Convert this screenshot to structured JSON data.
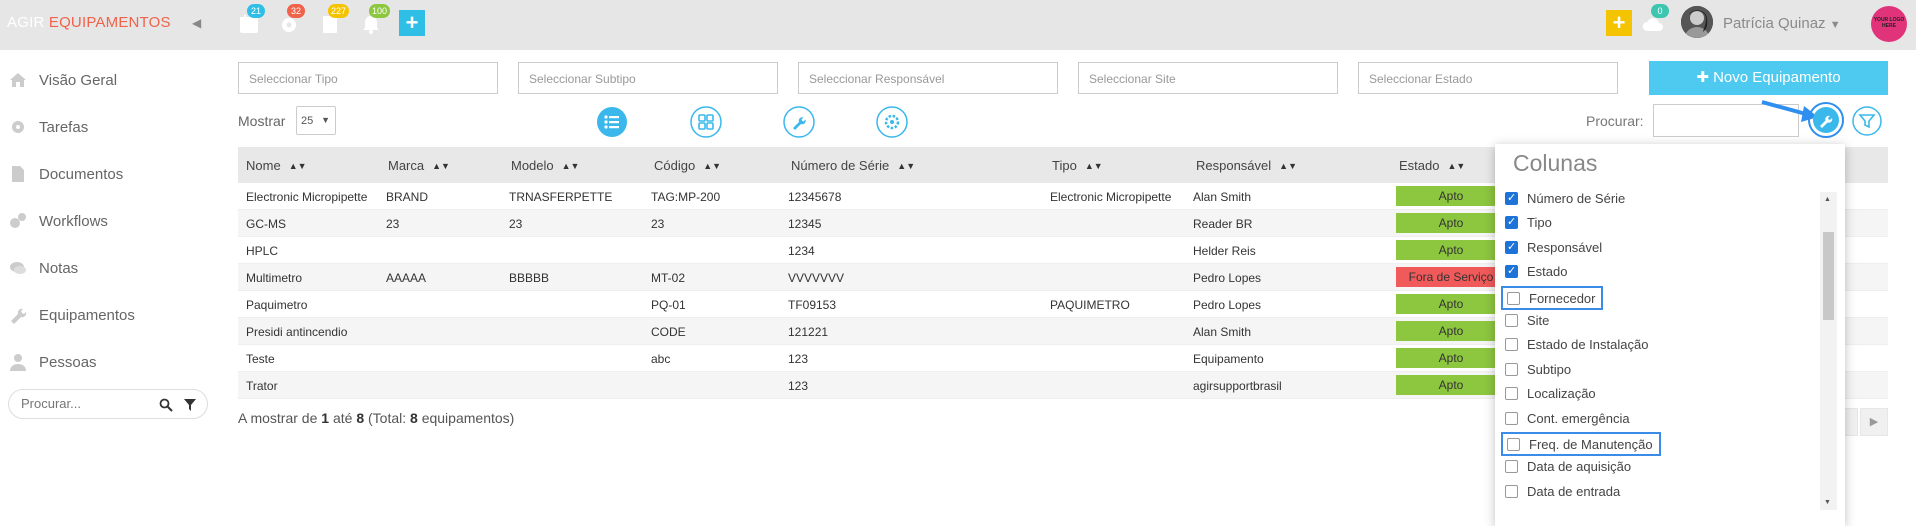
{
  "brand": {
    "part1": "AGIR",
    "part2": "EQUIPAMENTOS"
  },
  "topbar": {
    "badges": [
      {
        "name": "calendar-icon",
        "count": "21",
        "color": "#2fbfe6"
      },
      {
        "name": "gear-icon",
        "count": "32",
        "color": "#f0624a"
      },
      {
        "name": "document-icon",
        "count": "227",
        "color": "#f5c400"
      },
      {
        "name": "bell-icon",
        "count": "100",
        "color": "#8dc63f"
      }
    ],
    "cloud_count": "0",
    "user_name": "Patrícia Quinaz",
    "logo_text": "YOUR LOGO HERE"
  },
  "sidebar": {
    "items": [
      {
        "label": "Visão Geral",
        "icon": "home-icon"
      },
      {
        "label": "Tarefas",
        "icon": "gear-icon"
      },
      {
        "label": "Documentos",
        "icon": "document-icon"
      },
      {
        "label": "Workflows",
        "icon": "gears-icon"
      },
      {
        "label": "Notas",
        "icon": "chat-icon"
      },
      {
        "label": "Equipamentos",
        "icon": "wrench-icon"
      },
      {
        "label": "Pessoas",
        "icon": "person-icon"
      }
    ],
    "search_placeholder": "Procurar..."
  },
  "filters": {
    "tipo": "Seleccionar Tipo",
    "subtipo": "Seleccionar Subtipo",
    "responsavel": "Seleccionar Responsável",
    "site": "Seleccionar Site",
    "estado": "Seleccionar Estado"
  },
  "novo_button": "✚ Novo Equipamento",
  "toolbar": {
    "mostrar_label": "Mostrar",
    "mostrar_value": "25",
    "procurar_label": "Procurar:"
  },
  "table": {
    "headers": [
      "Nome",
      "Marca",
      "Modelo",
      "Código",
      "Número de Série",
      "Tipo",
      "Responsável",
      "Estado"
    ],
    "rows": [
      {
        "nome": "Electronic Micropipette",
        "marca": "BRAND",
        "modelo": "TRNASFERPETTE",
        "codigo": "TAG:MP-200",
        "serie": "12345678",
        "tipo": "Electronic Micropipette",
        "responsavel": "Alan Smith",
        "estado": "Apto"
      },
      {
        "nome": "GC-MS",
        "marca": "23",
        "modelo": "23",
        "codigo": "23",
        "serie": "12345",
        "tipo": "",
        "responsavel": "Reader BR",
        "estado": "Apto"
      },
      {
        "nome": "HPLC",
        "marca": "",
        "modelo": "",
        "codigo": "",
        "serie": "1234",
        "tipo": "",
        "responsavel": "Helder Reis",
        "estado": "Apto"
      },
      {
        "nome": "Multimetro",
        "marca": "AAAAA",
        "modelo": "BBBBB",
        "codigo": "MT-02",
        "serie": "VVVVVVV",
        "tipo": "",
        "responsavel": "Pedro Lopes",
        "estado": "Fora de Serviço"
      },
      {
        "nome": "Paquimetro",
        "marca": "",
        "modelo": "",
        "codigo": "PQ-01",
        "serie": "TF09153",
        "tipo": "PAQUIMETRO",
        "responsavel": "Pedro Lopes",
        "estado": "Apto"
      },
      {
        "nome": "Presidi antincendio",
        "marca": "",
        "modelo": "",
        "codigo": "CODE",
        "serie": "121221",
        "tipo": "",
        "responsavel": "Alan Smith",
        "estado": "Apto"
      },
      {
        "nome": "Teste",
        "marca": "",
        "modelo": "",
        "codigo": "abc",
        "serie": "123",
        "tipo": "",
        "responsavel": "Equipamento",
        "estado": "Apto"
      },
      {
        "nome": "Trator",
        "marca": "",
        "modelo": "",
        "codigo": "",
        "serie": "123",
        "tipo": "",
        "responsavel": "agirsupportbrasil",
        "estado": "Apto"
      }
    ],
    "status_colors": {
      "Apto": "#8dc63f",
      "Fora de Serviço": "#f05a5a"
    }
  },
  "footer": {
    "prefix": "A mostrar de",
    "from": "1",
    "mid": "até",
    "to": "8",
    "total_prefix": "(Total:",
    "total": "8",
    "total_suffix": "equipamentos)"
  },
  "columns_panel": {
    "title": "Colunas",
    "items": [
      {
        "label": "Número de Série",
        "checked": true
      },
      {
        "label": "Tipo",
        "checked": true
      },
      {
        "label": "Responsável",
        "checked": true
      },
      {
        "label": "Estado",
        "checked": true
      },
      {
        "label": "Fornecedor",
        "checked": false,
        "highlighted": true
      },
      {
        "label": "Site",
        "checked": false
      },
      {
        "label": "Estado de Instalação",
        "checked": false
      },
      {
        "label": "Subtipo",
        "checked": false
      },
      {
        "label": "Localização",
        "checked": false
      },
      {
        "label": "Cont. emergência",
        "checked": false
      },
      {
        "label": "Freq. de Manutenção",
        "checked": false,
        "highlighted": true
      },
      {
        "label": "Data de aquisição",
        "checked": false
      },
      {
        "label": "Data de entrada",
        "checked": false
      }
    ]
  }
}
